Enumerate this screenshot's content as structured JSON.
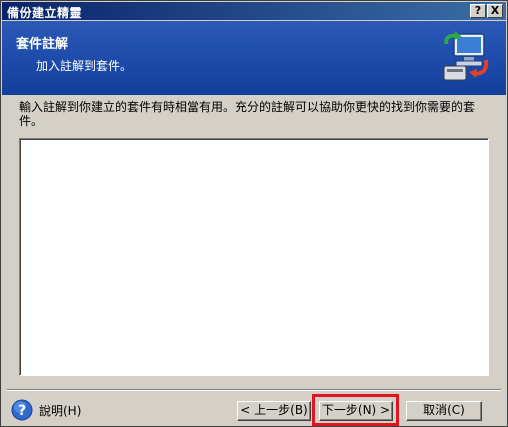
{
  "window": {
    "title": "備份建立精靈",
    "help_button": "?",
    "close_button": "X"
  },
  "header": {
    "title": "套件註解",
    "subtitle": "加入註解到套件。",
    "logo_icon": "backup-computer-icon"
  },
  "main": {
    "instructions": "輸入註解到你建立的套件有時相當有用。充分的註解可以協助你更快的找到你需要的套件。",
    "comment_value": ""
  },
  "footer": {
    "help_label": "說明(H)",
    "back_label": "< 上一步(B)",
    "next_label": "下一步(N) >",
    "cancel_label": "取消(C)"
  },
  "colors": {
    "header_bg": "#1f4ea8",
    "titlebar": "#0a246a",
    "highlight": "#e0151f"
  }
}
